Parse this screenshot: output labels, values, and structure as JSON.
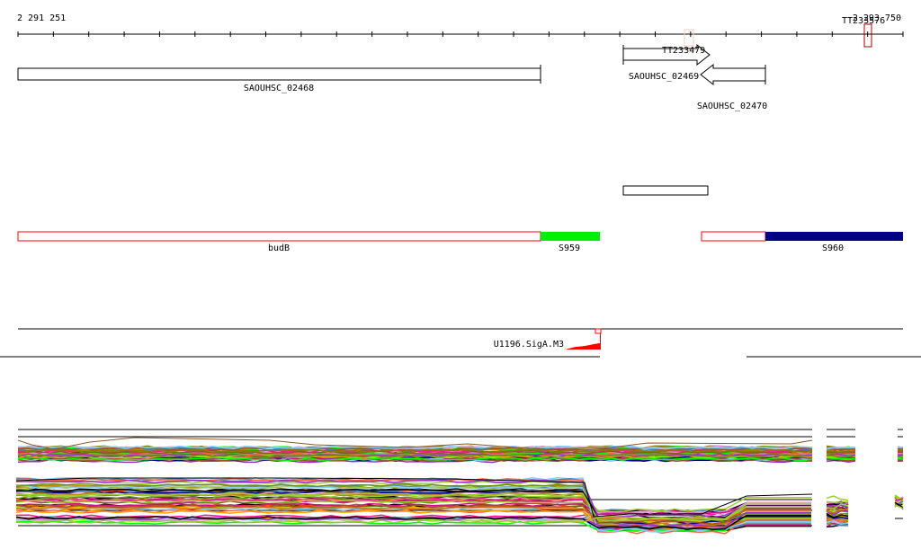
{
  "ruler": {
    "start_label": "2 291 251",
    "end_label": "2 293 750",
    "tick_count": 25
  },
  "terminators": [
    {
      "label": "TT233479"
    },
    {
      "label": "TT233576"
    }
  ],
  "genes": [
    {
      "label": "SAOUHSC_02468",
      "strand": "none"
    },
    {
      "label": "SAOUHSC_02469",
      "strand": "reverse"
    },
    {
      "label": "SAOUHSC_02470",
      "strand": "forward"
    }
  ],
  "operons": [
    {
      "label": "budB"
    },
    {
      "label": "S959"
    },
    {
      "label": "S960"
    }
  ],
  "motif": {
    "label": "U1196.SigA.M3"
  },
  "colors": {
    "gene_outline": "#000000",
    "operon_outline": "#ff0000",
    "s959": "#00ee00",
    "s960": "#000080",
    "motif": "#ff0000",
    "terminator": "#aa0000",
    "expression_palette": [
      "#000000",
      "#8b5a2b",
      "#6b8e23",
      "#ff4500",
      "#00ff00",
      "#87cefa",
      "#9932cc",
      "#ff1493",
      "#d2691e",
      "#808000",
      "#c71585",
      "#4682b4",
      "#b8860b",
      "#7fff00",
      "#a0522d",
      "#ffa500",
      "#00008b",
      "#ff6347",
      "#9acd32",
      "#dda0dd"
    ]
  }
}
